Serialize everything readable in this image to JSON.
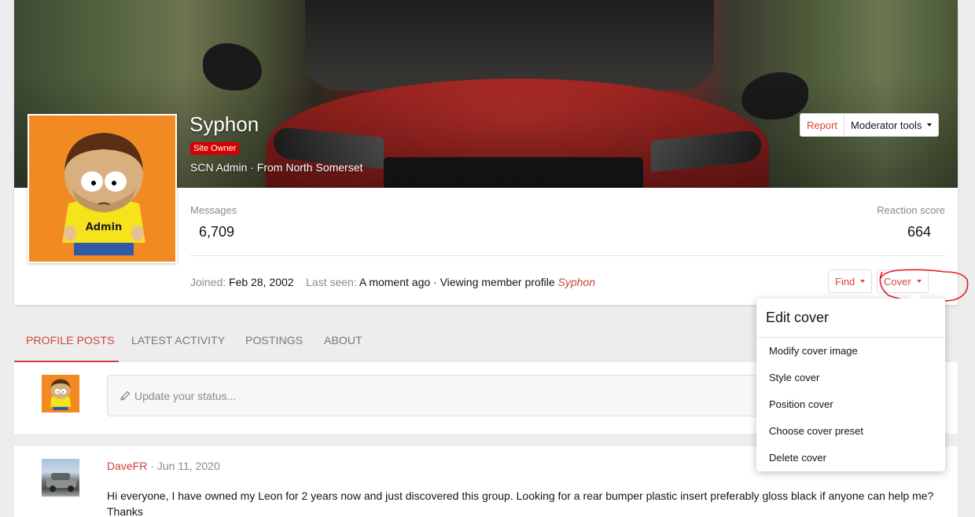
{
  "profile": {
    "username": "Syphon",
    "badge": "Site Owner",
    "user_title": "SCN Admin · From North Somerset",
    "avatar_text": "Admin"
  },
  "actions": {
    "report_label": "Report",
    "moderator_label": "Moderator tools",
    "find_label": "Find",
    "cover_label": "Cover"
  },
  "stats": {
    "messages_label": "Messages",
    "messages_value": "6,709",
    "reaction_label": "Reaction score",
    "reaction_value": "664"
  },
  "meta": {
    "joined_label": "Joined:",
    "joined_value": "Feb 28, 2002",
    "last_seen_label": "Last seen:",
    "last_seen_value": "A moment ago · Viewing member profile",
    "last_seen_link": "Syphon"
  },
  "tabs": [
    {
      "label": "PROFILE POSTS"
    },
    {
      "label": "LATEST ACTIVITY"
    },
    {
      "label": "POSTINGS"
    },
    {
      "label": "ABOUT"
    }
  ],
  "status": {
    "placeholder": "Update your status..."
  },
  "post": {
    "author": "DaveFR",
    "date": "Jun 11, 2020",
    "text": "Hi everyone, I have owned my Leon for 2 years now and just discovered this group. Looking for a rear bumper plastic insert preferably gloss black if anyone can help me? Thanks"
  },
  "cover_menu": {
    "title": "Edit cover",
    "items": [
      {
        "label": "Modify cover image"
      },
      {
        "label": "Style cover"
      },
      {
        "label": "Position cover"
      },
      {
        "label": "Choose cover preset"
      },
      {
        "label": "Delete cover"
      }
    ]
  },
  "colors": {
    "accent": "#d0423a",
    "badge": "#d50000",
    "avatar_bg": "#f28a24"
  }
}
